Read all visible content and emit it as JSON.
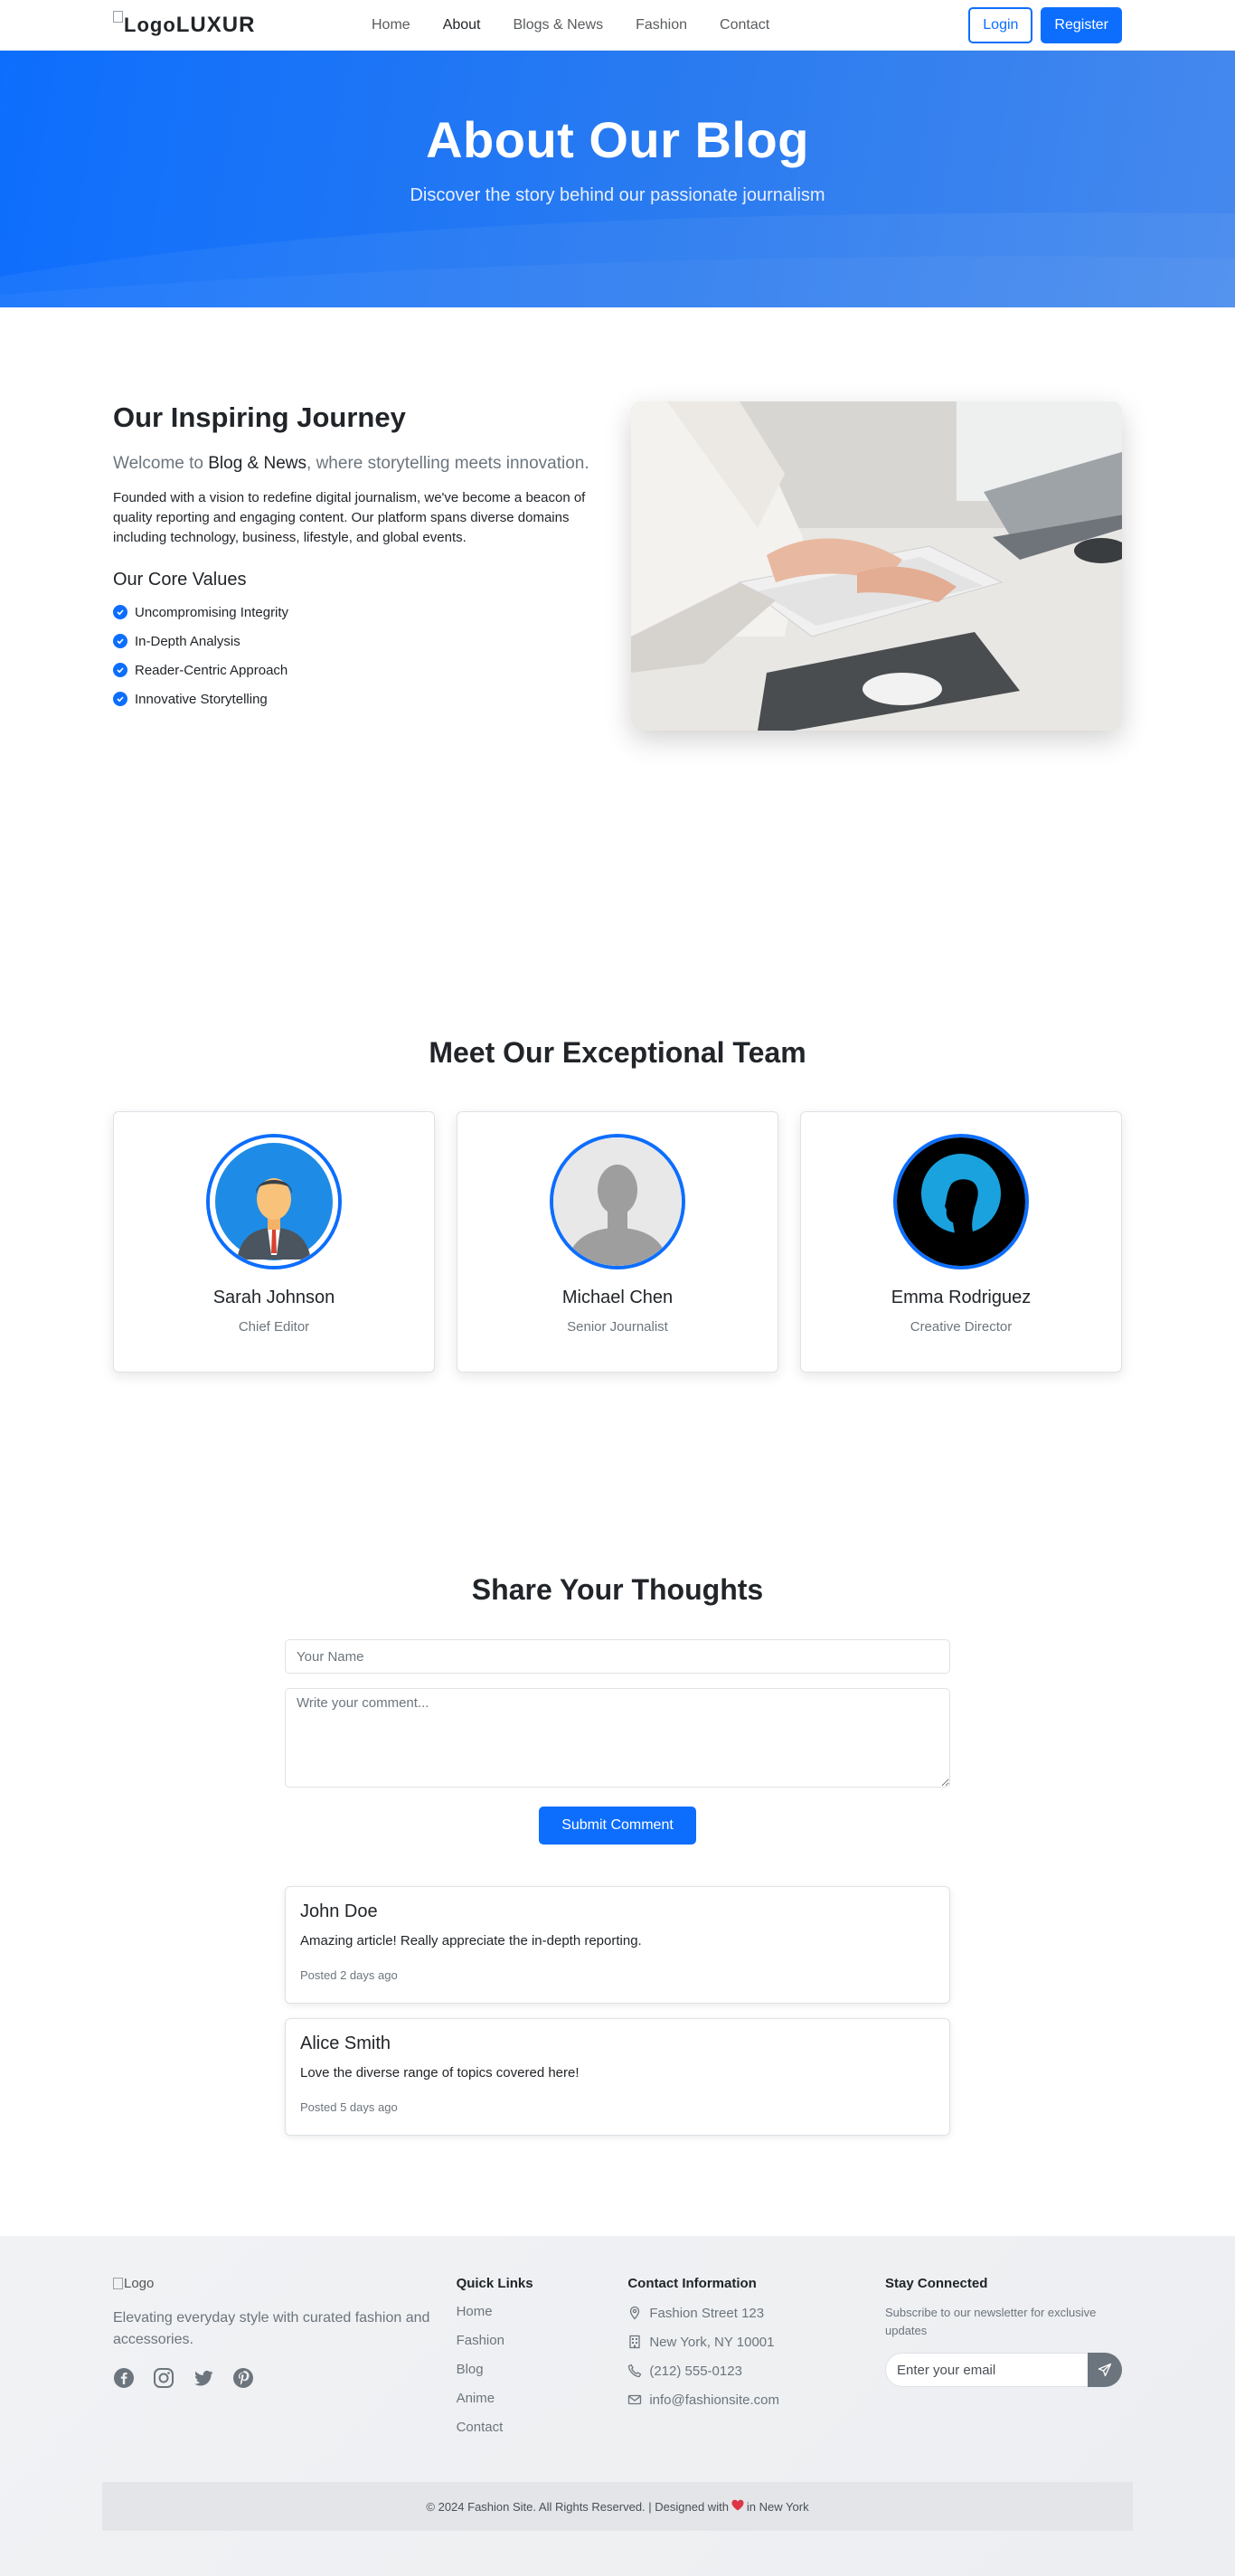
{
  "nav": {
    "logo_alt": "Logo",
    "brand": "LUXUR",
    "links": [
      "Home",
      "About",
      "Blogs & News",
      "Fashion",
      "Contact"
    ],
    "login": "Login",
    "register": "Register"
  },
  "hero": {
    "title": "About Our Blog",
    "subtitle": "Discover the story behind our passionate journalism"
  },
  "journey": {
    "title": "Our Inspiring Journey",
    "lead_prefix": "Welcome to ",
    "lead_brand": "Blog & News",
    "lead_suffix": ", where storytelling meets innovation.",
    "description": "Founded with a vision to redefine digital journalism, we've become a beacon of quality reporting and engaging content. Our platform spans diverse domains including technology, business, lifestyle, and global events.",
    "values_title": "Our Core Values",
    "values": [
      "Uncompromising Integrity",
      "In-Depth Analysis",
      "Reader-Centric Approach",
      "Innovative Storytelling"
    ]
  },
  "team": {
    "title": "Meet Our Exceptional Team",
    "members": [
      {
        "name": "Sarah Johnson",
        "role": "Chief Editor"
      },
      {
        "name": "Michael Chen",
        "role": "Senior Journalist"
      },
      {
        "name": "Emma Rodriguez",
        "role": "Creative Director"
      }
    ]
  },
  "thoughts": {
    "title": "Share Your Thoughts",
    "name_placeholder": "Your Name",
    "comment_placeholder": "Write your comment...",
    "submit": "Submit Comment",
    "comments": [
      {
        "name": "John Doe",
        "text": "Amazing article! Really appreciate the in-depth reporting.",
        "time": "Posted 2 days ago"
      },
      {
        "name": "Alice Smith",
        "text": "Love the diverse range of topics covered here!",
        "time": "Posted 5 days ago"
      }
    ]
  },
  "footer": {
    "logo_alt": "Logo",
    "tagline": "Elevating everyday style with curated fashion and accessories.",
    "quick_links_title": "Quick Links",
    "quick_links": [
      "Home",
      "Fashion",
      "Blog",
      "Anime",
      "Contact"
    ],
    "contact_title": "Contact Information",
    "contact": [
      "Fashion Street 123",
      "New York, NY 10001",
      "(212) 555-0123",
      "info@fashionsite.com"
    ],
    "stay_title": "Stay Connected",
    "stay_sub": "Subscribe to our newsletter for exclusive updates",
    "email_placeholder": "Enter your email",
    "copyright_a": "© 2024 Fashion Site. All Rights Reserved. | Designed with",
    "copyright_b": "in New York"
  },
  "colors": {
    "primary": "#0d6efd",
    "muted": "#6c757d",
    "heart": "#dc3545"
  }
}
